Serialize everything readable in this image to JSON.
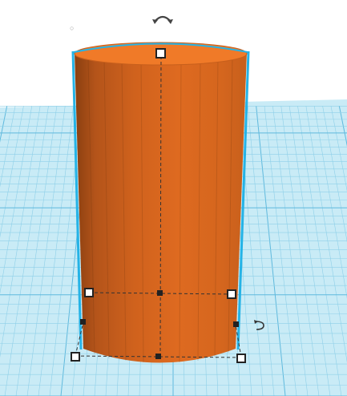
{
  "scene": {
    "workplane_color": "#c9ebf6",
    "workplane_line_color": "#8fd0e8",
    "object": {
      "shape": "cylinder",
      "color": "#e06a1e",
      "selection_outline_color": "#25b3e6"
    },
    "icons": {
      "rotate_top": "rotate-arrow-icon",
      "rotate_side": "rotate-side-arrow-icon"
    },
    "corner_glyph": "○"
  }
}
